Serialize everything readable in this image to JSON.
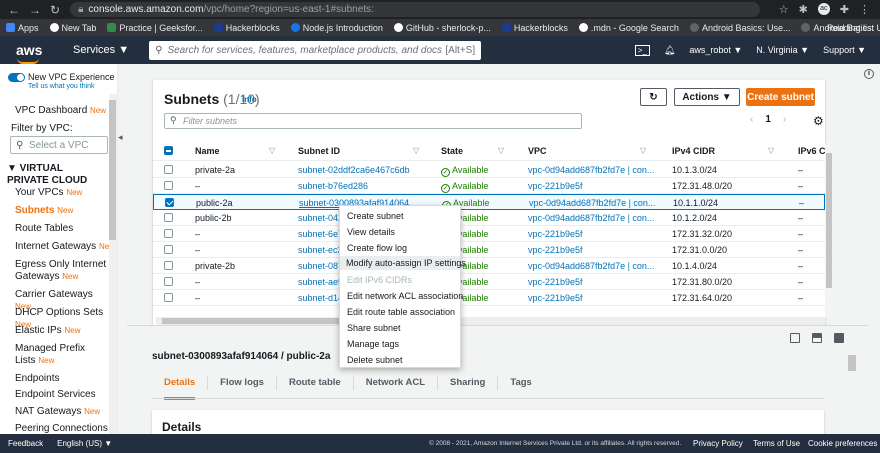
{
  "browser": {
    "url_host": "console.aws.amazon.com",
    "url_path": "/vpc/home?region=us-east-1#subnets:",
    "bookmarks": [
      "Apps",
      "New Tab",
      "Practice | Geeksfor...",
      "Hackerblocks",
      "Node.js Introduction",
      "GitHub - sherlock-p...",
      "Hackerblocks",
      ".mdn - Google Search",
      "Android Basics: Use...",
      "Android Batics: Use..."
    ],
    "reading_list": "Reading list",
    "profile_initials": "ac"
  },
  "aws_nav": {
    "logo": "aws",
    "services": "Services ▼",
    "search_placeholder": "Search for services, features, marketplace products, and docs",
    "search_shortcut": "[Alt+S]",
    "user": "aws_robot ▼",
    "region": "N. Virginia ▼",
    "support": "Support ▼"
  },
  "sidebar": {
    "experience_title": "New VPC Experience",
    "experience_link": "Tell us what you think",
    "dashboard": "VPC Dashboard",
    "new_badge": "New",
    "filter_label": "Filter by VPC:",
    "select_placeholder": "Select a VPC",
    "section": "▼ VIRTUAL PRIVATE CLOUD",
    "items": [
      {
        "label": "Your VPCs",
        "new": "New"
      },
      {
        "label": "Subnets",
        "new": "New"
      },
      {
        "label": "Route Tables",
        "new": ""
      },
      {
        "label": "Internet Gateways",
        "new": "New"
      },
      {
        "label": "Egress Only Internet Gateways",
        "new": "New"
      },
      {
        "label": "Carrier Gateways",
        "new": "New"
      },
      {
        "label": "DHCP Options Sets",
        "new": "New"
      },
      {
        "label": "Elastic IPs",
        "new": "New"
      },
      {
        "label": "Managed Prefix Lists",
        "new": "New"
      },
      {
        "label": "Endpoints",
        "new": ""
      },
      {
        "label": "Endpoint Services",
        "new": ""
      },
      {
        "label": "NAT Gateways",
        "new": "New"
      },
      {
        "label": "Peering Connections",
        "new": ""
      }
    ]
  },
  "subnets_panel": {
    "title": "Subnets",
    "count": "(1/10)",
    "info": "Info",
    "actions": "Actions ▼",
    "create": "Create subnet",
    "filter_placeholder": "Filter subnets",
    "page": "1",
    "columns": [
      "Name",
      "Subnet ID",
      "State",
      "VPC",
      "IPv4 CIDR",
      "IPv6 CI"
    ],
    "rows": [
      {
        "name": "private-2a",
        "id": "subnet-02ddf2ca6e467c6db",
        "state": "Available",
        "vpc": "vpc-0d94add687fb2fd7e | con...",
        "cidr": "10.1.3.0/24",
        "ipv6": "–",
        "selected": false
      },
      {
        "name": "–",
        "id": "subnet-b76ed286",
        "state": "Available",
        "vpc": "vpc-221b9e5f",
        "cidr": "172.31.48.0/20",
        "ipv6": "–",
        "selected": false
      },
      {
        "name": "public-2a",
        "id": "subnet-0300893afaf914064",
        "state": "Available",
        "vpc": "vpc-0d94add687fb2fd7e | con...",
        "cidr": "10.1.1.0/24",
        "ipv6": "–",
        "selected": true
      },
      {
        "name": "public-2b",
        "id": "subnet-042",
        "state": "Available",
        "vpc": "vpc-0d94add687fb2fd7e | con...",
        "cidr": "10.1.2.0/24",
        "ipv6": "–",
        "selected": false
      },
      {
        "name": "–",
        "id": "subnet-6e7",
        "state": "Available",
        "vpc": "vpc-221b9e5f",
        "cidr": "172.31.32.0/20",
        "ipv6": "–",
        "selected": false
      },
      {
        "name": "–",
        "id": "subnet-ec3",
        "state": "Available",
        "vpc": "vpc-221b9e5f",
        "cidr": "172.31.0.0/20",
        "ipv6": "–",
        "selected": false
      },
      {
        "name": "private-2b",
        "id": "subnet-087",
        "state": "Available",
        "vpc": "vpc-0d94add687fb2fd7e | con...",
        "cidr": "10.1.4.0/24",
        "ipv6": "–",
        "selected": false
      },
      {
        "name": "–",
        "id": "subnet-ae9",
        "state": "Available",
        "vpc": "vpc-221b9e5f",
        "cidr": "172.31.80.0/20",
        "ipv6": "–",
        "selected": false
      },
      {
        "name": "–",
        "id": "subnet-d14",
        "state": "Available",
        "vpc": "vpc-221b9e5f",
        "cidr": "172.31.64.0/20",
        "ipv6": "–",
        "selected": false
      }
    ]
  },
  "context_menu": [
    {
      "label": "Create subnet",
      "disabled": false
    },
    {
      "label": "View details",
      "disabled": false
    },
    {
      "label": "Create flow log",
      "disabled": false
    },
    {
      "label": "Modify auto-assign IP settings",
      "disabled": false
    },
    {
      "label": "Edit IPv6 CIDRs",
      "disabled": true
    },
    {
      "label": "Edit network ACL association",
      "disabled": false
    },
    {
      "label": "Edit route table association",
      "disabled": false
    },
    {
      "label": "Share subnet",
      "disabled": false
    },
    {
      "label": "Manage tags",
      "disabled": false
    },
    {
      "label": "Delete subnet",
      "disabled": false
    }
  ],
  "detail": {
    "title": "subnet-0300893afaf914064 / public-2a",
    "tabs": [
      "Details",
      "Flow logs",
      "Route table",
      "Network ACL",
      "Sharing",
      "Tags"
    ],
    "section": "Details"
  },
  "footer": {
    "feedback": "Feedback",
    "language": "English (US) ▼",
    "copyright": "© 2008 - 2021, Amazon Internet Services Private Ltd. or its affiliates. All rights reserved.",
    "privacy": "Privacy Policy",
    "terms": "Terms of Use",
    "cookies": "Cookie preferences"
  },
  "colors": {
    "accent": "#ec7211",
    "link": "#0073bb",
    "nav": "#232f3e",
    "available": "#1d8102"
  }
}
